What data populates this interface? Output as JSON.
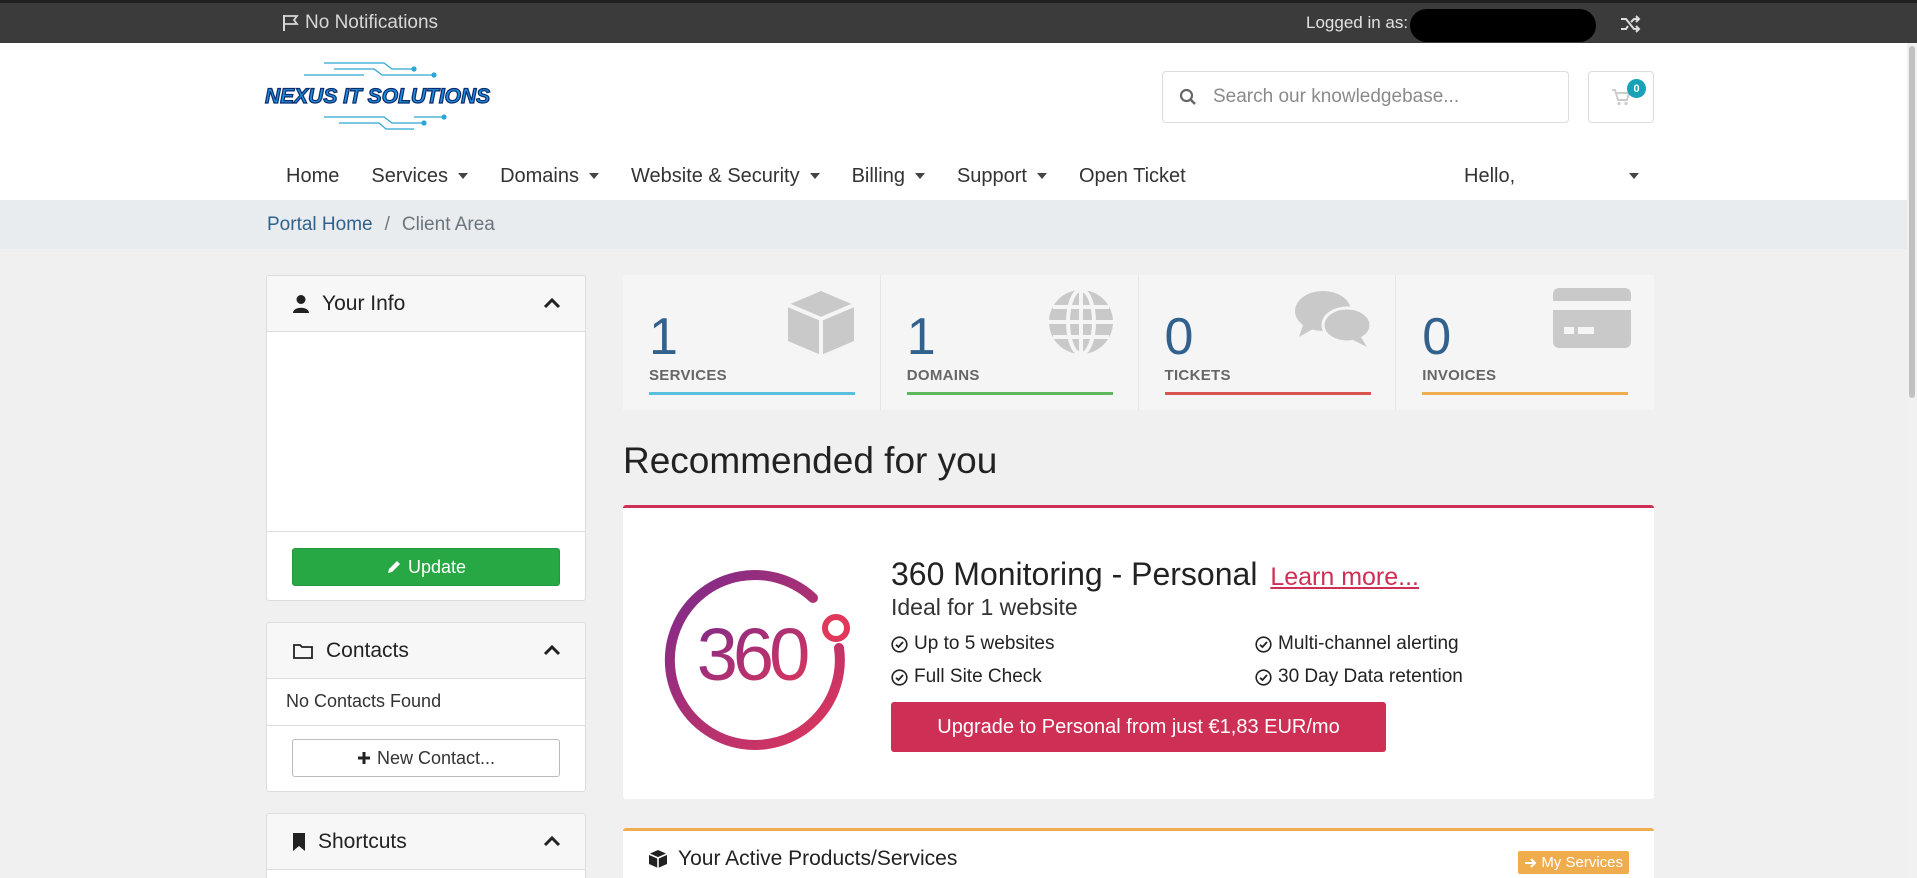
{
  "topbar": {
    "notifications": "No Notifications",
    "logged_in_label": "Logged in as:"
  },
  "brand": {
    "logo_text": "NEXUS IT SOLUTIONS"
  },
  "search": {
    "placeholder": "Search our knowledgebase..."
  },
  "cart": {
    "count": "0"
  },
  "nav": {
    "home": "Home",
    "services": "Services",
    "domains": "Domains",
    "website_security": "Website & Security",
    "billing": "Billing",
    "support": "Support",
    "open_ticket": "Open Ticket",
    "hello": "Hello,"
  },
  "breadcrumb": {
    "home": "Portal Home",
    "separator": "/",
    "current": "Client Area"
  },
  "sidebar": {
    "your_info": {
      "title": "Your Info",
      "update_label": "Update"
    },
    "contacts": {
      "title": "Contacts",
      "empty": "No Contacts Found",
      "new_label": "New Contact..."
    },
    "shortcuts": {
      "title": "Shortcuts"
    }
  },
  "stats": [
    {
      "value": "1",
      "label": "SERVICES",
      "color": "#5bc0de"
    },
    {
      "value": "1",
      "label": "DOMAINS",
      "color": "#5cb85c"
    },
    {
      "value": "0",
      "label": "TICKETS",
      "color": "#d9534f"
    },
    {
      "value": "0",
      "label": "INVOICES",
      "color": "#f0ad4e"
    }
  ],
  "recommended": {
    "heading": "Recommended for you",
    "product_title": "360 Monitoring - Personal",
    "learn_more": "Learn more...",
    "subtitle": "Ideal for 1 website",
    "logo_text": "360",
    "features": [
      "Up to 5 websites",
      "Multi-channel alerting",
      "Full Site Check",
      "30 Day Data retention"
    ],
    "cta": "Upgrade to Personal from just €1,83 EUR/mo",
    "accent": "#ce2f55"
  },
  "active_products": {
    "title": "Your Active Products/Services",
    "button": "My Services"
  }
}
